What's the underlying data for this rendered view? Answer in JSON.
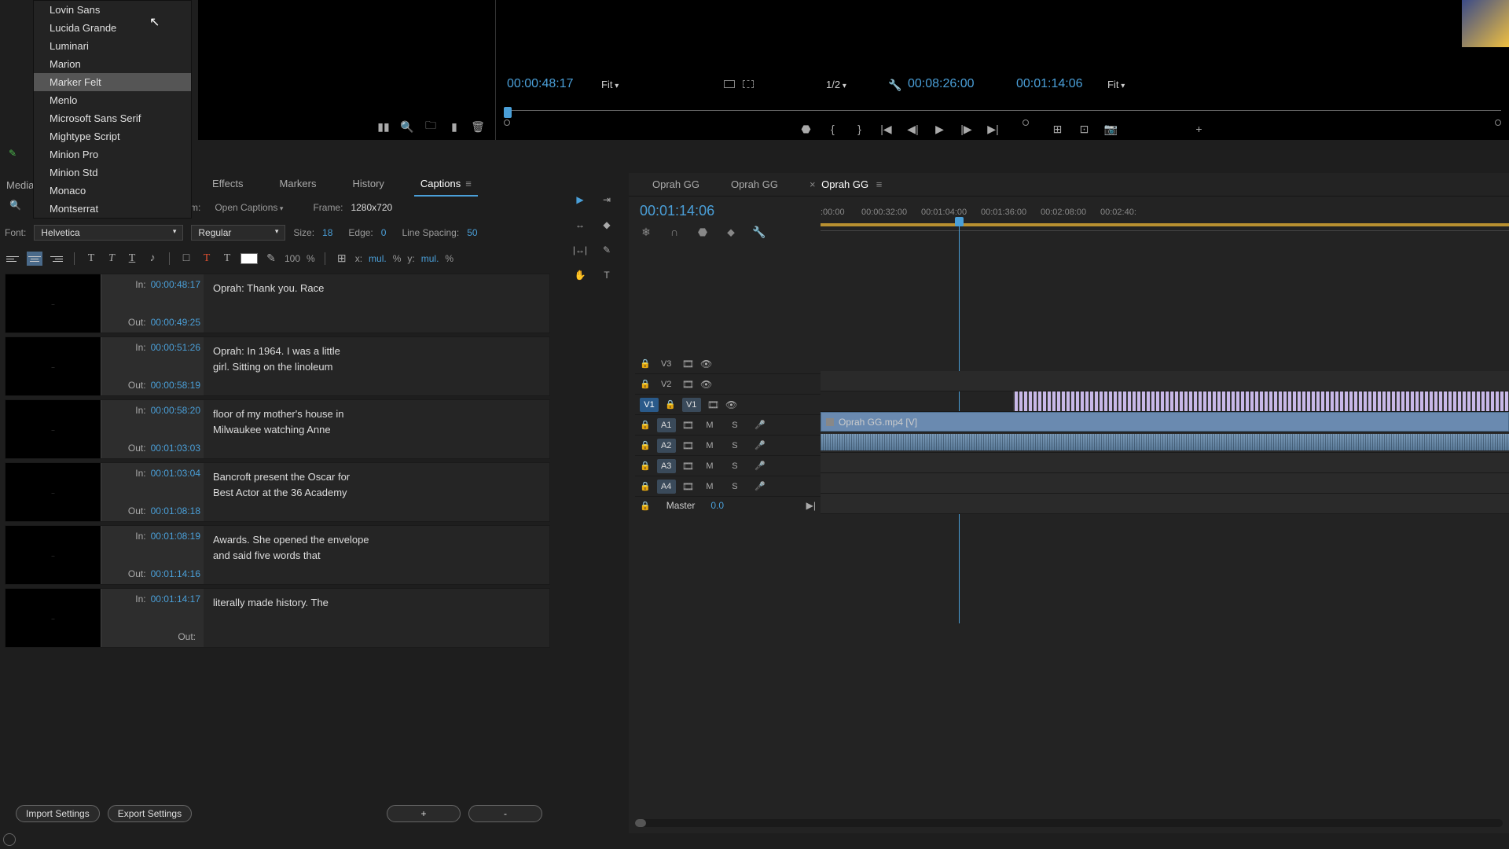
{
  "fontMenu": {
    "items": [
      "Lovin Sans",
      "Lucida Grande",
      "Luminari",
      "Marion",
      "Marker Felt",
      "Menlo",
      "Microsoft Sans Serif",
      "Mightype Script",
      "Minion Pro",
      "Minion Std",
      "Monaco",
      "Montserrat"
    ],
    "highlighted": "Marker Felt"
  },
  "sourceMonitor": {
    "tc": "00:00:48:17",
    "zoom": "Fit"
  },
  "programMonitor": {
    "zoom": "1/2",
    "tc_left": "00:08:26:00",
    "tc_right": "00:01:14:06",
    "fit": "Fit"
  },
  "panelTabs": {
    "media": "Media",
    "effects": "Effects",
    "markers": "Markers",
    "history": "History",
    "captions": "Captions"
  },
  "captionSettings": {
    "stream_label_suffix": "m:",
    "stream_value": "Open Captions",
    "frame_label": "Frame:",
    "frame_value": "1280x720",
    "font_label": "Font:",
    "font_value": "Helvetica",
    "weight": "Regular",
    "size_label": "Size:",
    "size_value": "18",
    "edge_label": "Edge:",
    "edge_value": "0",
    "linespacing_label": "Line Spacing:",
    "linespacing_value": "50",
    "opacity": "100",
    "pct": "%",
    "x_label": "x:",
    "x_value": "mul.",
    "y_label": "y:",
    "y_value": "mul."
  },
  "captions": [
    {
      "in": "00:00:48:17",
      "out": "00:00:49:25",
      "text": "Oprah: Thank you. Race"
    },
    {
      "in": "00:00:51:26",
      "out": "00:00:58:19",
      "text": "Oprah: In 1964. I was a little\ngirl. Sitting on the linoleum"
    },
    {
      "in": "00:00:58:20",
      "out": "00:01:03:03",
      "text": "floor of my mother's house in\nMilwaukee watching Anne"
    },
    {
      "in": "00:01:03:04",
      "out": "00:01:08:18",
      "text": "Bancroft present the Oscar for\nBest Actor at the 36 Academy"
    },
    {
      "in": "00:01:08:19",
      "out": "00:01:14:16",
      "text": "Awards. She opened the envelope\nand said five words that"
    },
    {
      "in": "00:01:14:17",
      "out": "",
      "text": "literally made history. The"
    }
  ],
  "captionLabels": {
    "in": "In:",
    "out": "Out:"
  },
  "bottomButtons": {
    "import": "Import Settings",
    "export": "Export Settings",
    "plus": "+",
    "minus": "-"
  },
  "timeline": {
    "seq": "Oprah GG",
    "tc": "00:01:14:06",
    "ticks": [
      ":00:00",
      "00:00:32:00",
      "00:01:04:00",
      "00:01:36:00",
      "00:02:08:00",
      "00:02:40:"
    ],
    "clip": "Oprah GG.mp4 [V]",
    "tracks": {
      "v3": "V3",
      "v2": "V2",
      "v1": "V1",
      "a1": "A1",
      "a2": "A2",
      "a3": "A3",
      "a4": "A4",
      "master": "Master",
      "master_val": "0.0",
      "mute": "M",
      "solo": "S"
    }
  }
}
